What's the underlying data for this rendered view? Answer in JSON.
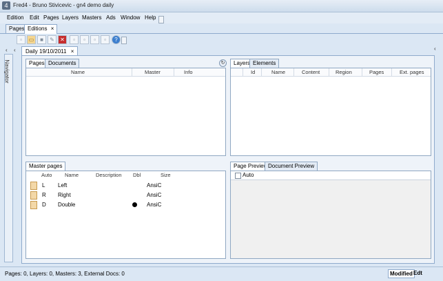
{
  "window": {
    "title": "Fred4 - Bruno Stivicevic - gn4 demo daily"
  },
  "menu": [
    {
      "label": "Edition"
    },
    {
      "label": "Edit"
    },
    {
      "label": "Pages"
    },
    {
      "label": "Layers"
    },
    {
      "label": "Masters"
    },
    {
      "label": "Ads"
    },
    {
      "label": "Window"
    },
    {
      "label": "Help"
    }
  ],
  "top_tabs": [
    {
      "label": "Pages"
    },
    {
      "label": "Editions",
      "close": "×"
    }
  ],
  "edition_tab": {
    "label": "Daily 19/10/2011",
    "close": "×"
  },
  "navigator": {
    "label": "Navigator"
  },
  "pages_panel": {
    "tabs": [
      {
        "label": "Pages"
      },
      {
        "label": "Documents"
      }
    ],
    "columns": [
      "Name",
      "Master",
      "Info"
    ]
  },
  "layers_panel": {
    "tabs": [
      {
        "label": "Layers"
      },
      {
        "label": "Elements"
      }
    ],
    "columns": [
      "Id",
      "Name",
      "Content",
      "Region",
      "Pages",
      "Ext. pages"
    ]
  },
  "master_pages": {
    "tab": "Master pages",
    "columns": [
      "Auto",
      "Name",
      "Description",
      "Dbl",
      "Size"
    ],
    "rows": [
      {
        "auto": "L",
        "name": "Left",
        "description": "",
        "dbl": false,
        "size": "AnsiC"
      },
      {
        "auto": "R",
        "name": "Right",
        "description": "",
        "dbl": false,
        "size": "AnsiC"
      },
      {
        "auto": "D",
        "name": "Double",
        "description": "",
        "dbl": true,
        "size": "AnsiC"
      }
    ]
  },
  "preview": {
    "tabs": [
      {
        "label": "Page Preview"
      },
      {
        "label": "Document Preview"
      }
    ],
    "auto_label": "Auto"
  },
  "status": {
    "text": "Pages: 0, Layers: 0, Masters: 3, External Docs: 0",
    "modified": "Modified",
    "mode": "Edt"
  },
  "colors": {
    "panel_border": "#8fa7c2",
    "window_bg": "#dbe7f4"
  }
}
